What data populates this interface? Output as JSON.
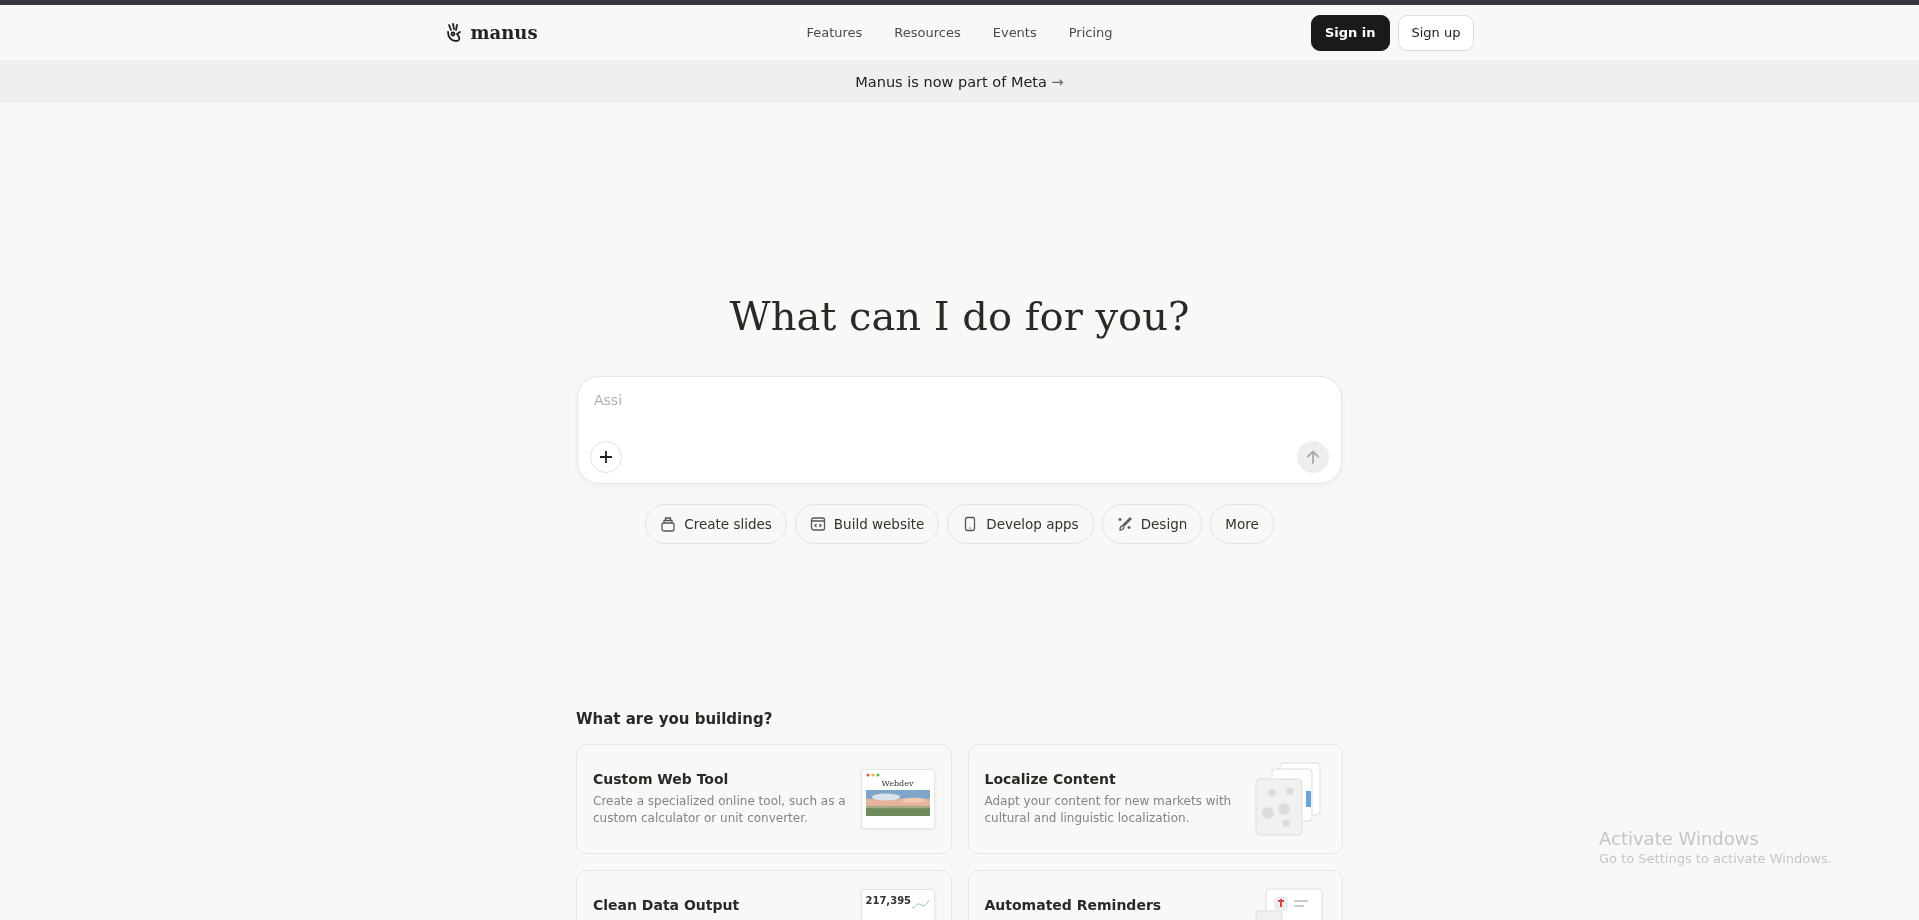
{
  "header": {
    "logo": "manus",
    "nav": [
      "Features",
      "Resources",
      "Events",
      "Pricing"
    ],
    "buttons": [
      {
        "label": "Sign in",
        "kind": "primary"
      },
      {
        "label": "Sign up",
        "kind": "secondary"
      }
    ]
  },
  "banner": {
    "text": "Manus is now part of Meta",
    "arrow": "→"
  },
  "hero": {
    "title": "What can I do for you?",
    "input": {
      "placeholder": "Assi"
    }
  },
  "chips": [
    {
      "label": "Create slides",
      "kind": "slides"
    },
    {
      "label": "Build website",
      "kind": "website"
    },
    {
      "label": "Develop apps",
      "kind": "apps"
    },
    {
      "label": "Design",
      "kind": "design"
    },
    {
      "label": "More",
      "kind": "more"
    }
  ],
  "section": {
    "title": "What are you building?"
  },
  "cards": [
    {
      "title": "Custom Web Tool",
      "description": "Create a specialized online tool, such as a custom calculator or unit converter.",
      "kind": "web",
      "thumb_text": "Webdev"
    },
    {
      "title": "Localize Content",
      "description": "Adapt your content for new markets with cultural and linguistic localization.",
      "kind": "localize"
    },
    {
      "title": "Clean Data Output",
      "kind": "data",
      "thumb_text": "217,395"
    },
    {
      "title": "Automated Reminders",
      "kind": "reminders"
    }
  ],
  "os_notice": {
    "title": "Activate Windows",
    "text": "Go to Settings to activate Windows."
  }
}
